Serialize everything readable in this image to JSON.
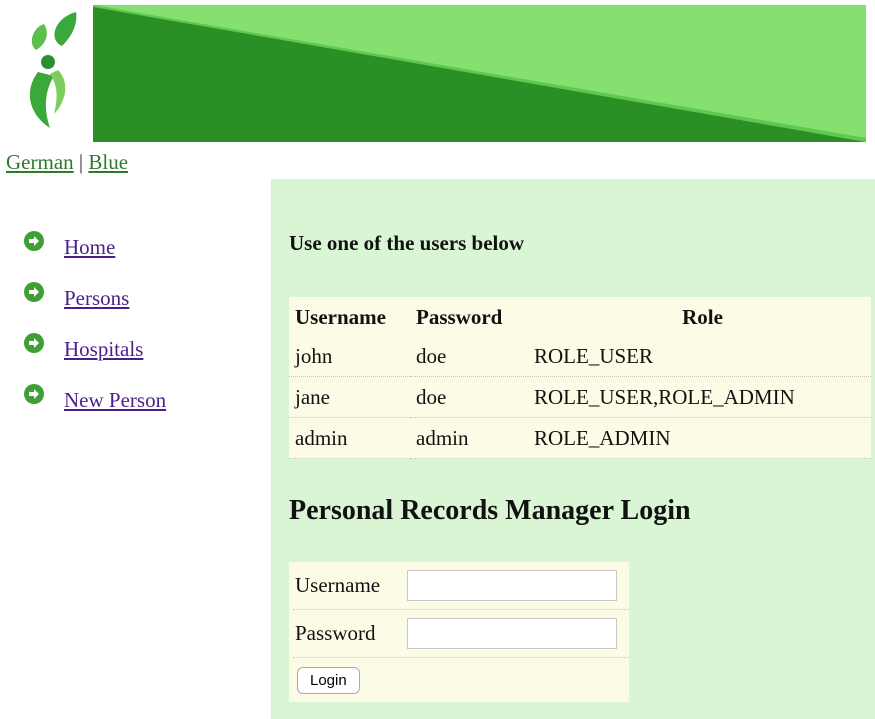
{
  "language_links": {
    "german": "German",
    "separator": "|",
    "blue": "Blue"
  },
  "nav": {
    "items": [
      {
        "label": "Home"
      },
      {
        "label": "Persons"
      },
      {
        "label": "Hospitals"
      },
      {
        "label": "New Person"
      }
    ]
  },
  "main": {
    "hint": "Use one of the users below",
    "table": {
      "headers": [
        "Username",
        "Password",
        "Role"
      ],
      "rows": [
        [
          "john",
          "doe",
          "ROLE_USER"
        ],
        [
          "jane",
          "doe",
          "ROLE_USER,ROLE_ADMIN"
        ],
        [
          "admin",
          "admin",
          "ROLE_ADMIN"
        ]
      ]
    },
    "title": "Personal Records Manager Login",
    "form": {
      "username_label": "Username",
      "password_label": "Password",
      "username_value": "",
      "password_value": "",
      "login_label": "Login"
    }
  },
  "colors": {
    "banner_dark": "#228c22",
    "banner_light": "#86e070",
    "panel_bg": "#d9f5d3",
    "table_bg": "#fbfbe6",
    "link": "#4a1f8c",
    "lang_link": "#2d7a2d"
  },
  "icons": {
    "logo": "leaf-figure-logo",
    "nav_bullet": "green-arrow-circle-icon"
  }
}
